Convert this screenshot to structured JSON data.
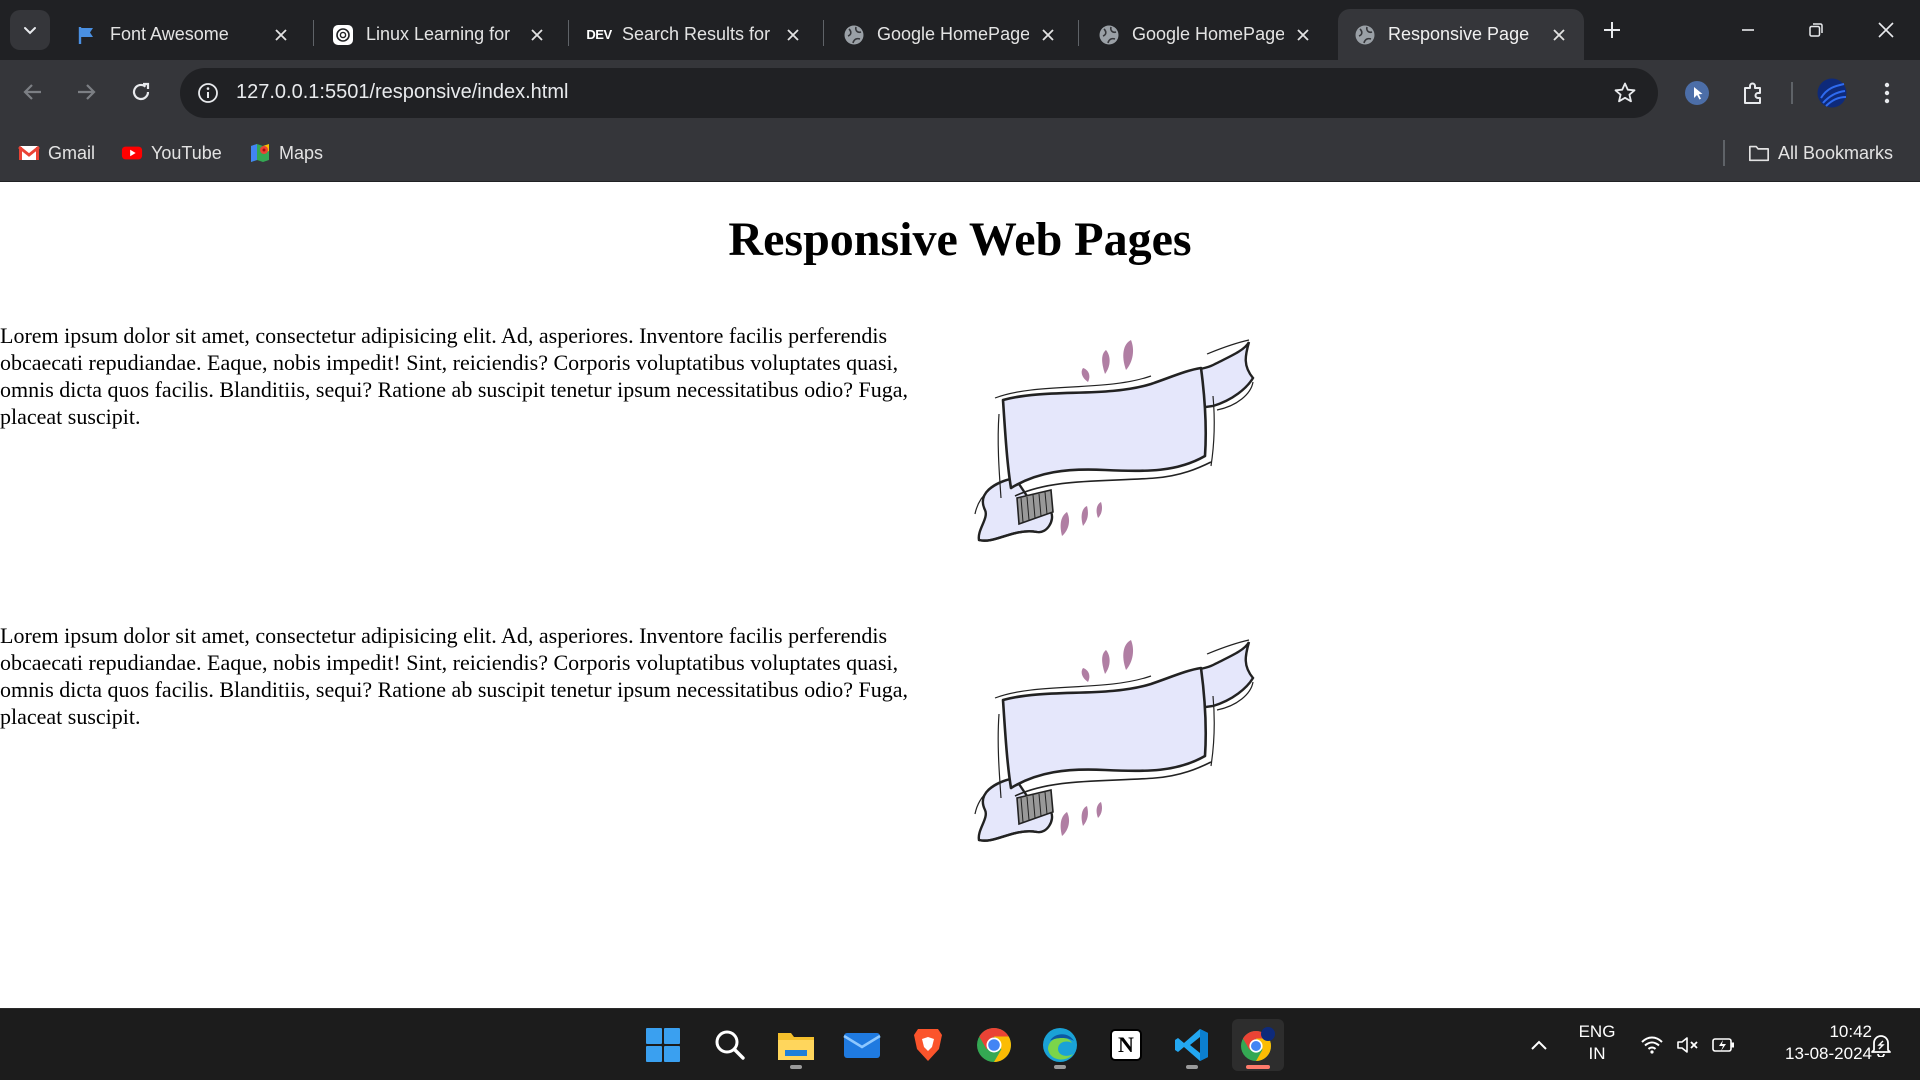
{
  "browser": {
    "tabs": [
      {
        "title": "Font Awesome",
        "favicon": "flag-icon",
        "active": false
      },
      {
        "title": "Linux Learning for",
        "favicon": "chatgpt-icon",
        "active": false
      },
      {
        "title": "Search Results for",
        "favicon": "dev-icon",
        "active": false
      },
      {
        "title": "Google HomePage",
        "favicon": "globe-icon",
        "active": false
      },
      {
        "title": "Google HomePage",
        "favicon": "globe-icon",
        "active": false
      },
      {
        "title": "Responsive Page",
        "favicon": "globe-icon",
        "active": true
      }
    ],
    "dev_favicon_text": "DEV",
    "url": "127.0.0.1:5501/responsive/index.html",
    "bookmarks": [
      {
        "label": "Gmail",
        "icon": "gmail-icon"
      },
      {
        "label": "YouTube",
        "icon": "youtube-icon"
      },
      {
        "label": "Maps",
        "icon": "maps-icon"
      }
    ],
    "all_bookmarks_label": "All Bookmarks"
  },
  "page": {
    "title": "Responsive Web Pages",
    "sections": [
      {
        "text": "Lorem ipsum dolor sit amet, consectetur adipisicing elit. Ad, asperiores. Inventore facilis perferendis obcaecati repudiandae. Eaque, nobis impedit! Sint, reiciendis? Corporis voluptatibus voluptates quasi, omnis dicta quos facilis. Blanditiis, sequi? Ratione ab suscipit tenetur ipsum necessitatibus odio? Fuga, placeat suscipit.",
        "image": "ribbon-banner-illustration"
      },
      {
        "text": "Lorem ipsum dolor sit amet, consectetur adipisicing elit. Ad, asperiores. Inventore facilis perferendis obcaecati repudiandae. Eaque, nobis impedit! Sint, reiciendis? Corporis voluptatibus voluptates quasi, omnis dicta quos facilis. Blanditiis, sequi? Ratione ab suscipit tenetur ipsum necessitatibus odio? Fuga, placeat suscipit.",
        "image": "ribbon-banner-illustration"
      }
    ]
  },
  "taskbar": {
    "apps": [
      "windows-start-icon",
      "search-icon",
      "file-explorer-icon",
      "mail-icon",
      "brave-icon",
      "chrome-icon",
      "edge-icon",
      "notion-icon",
      "vscode-icon",
      "chrome-icon"
    ],
    "notion_letter": "N",
    "language": {
      "line1": "ENG",
      "line2": "IN"
    },
    "time": "10:42",
    "date": "13-08-2024"
  },
  "colors": {
    "ribbon_fill": "#e5e7fb",
    "ribbon_accent": "#b07ea3",
    "accent_active_tab": "#35363a"
  }
}
